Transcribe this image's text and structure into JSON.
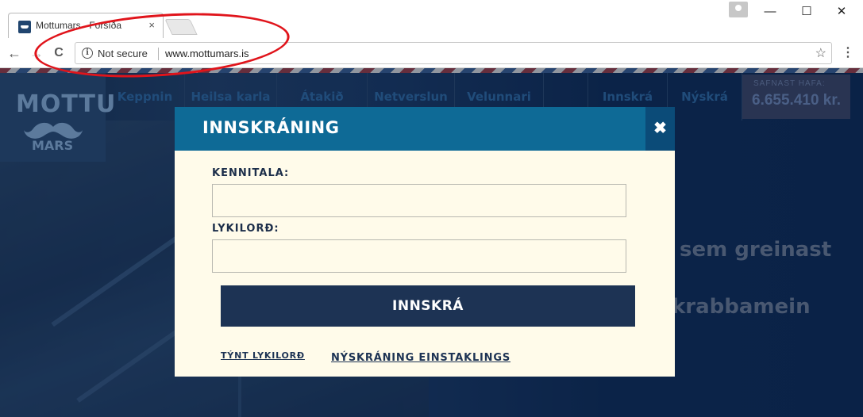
{
  "browser": {
    "tab_title": "Mottumars - Forsíða",
    "tab_close": "×",
    "toolbar": {
      "back_icon": "←",
      "forward_icon": "→",
      "reload_icon": "C",
      "security_label": "Not secure",
      "url": "www.mottumars.is",
      "star_icon": "☆",
      "menu_icon": "⋮"
    },
    "window_controls": {
      "minimize": "—",
      "maximize": "☐",
      "close": "✕"
    }
  },
  "site": {
    "logo": {
      "line1": "MOTTU",
      "line2": "MARS"
    },
    "nav": [
      {
        "label": "Keppnin"
      },
      {
        "label": "Heilsa karla"
      },
      {
        "label": "Átakið"
      },
      {
        "label": "Netverslun"
      },
      {
        "label": "Velunnari"
      },
      {
        "label": ""
      },
      {
        "label": "Innskrá"
      },
      {
        "label": "Nýskrá"
      }
    ],
    "funds": {
      "label": "SAFNAST HAFA:",
      "amount": "6.655.410 kr."
    },
    "hero_lines": [
      "sem greinast",
      "krabbamein"
    ]
  },
  "modal": {
    "title": "INNSKRÁNING",
    "close_icon": "✖",
    "fields": [
      {
        "label": "KENNITALA:",
        "value": "",
        "placeholder": ""
      },
      {
        "label": "LYKILORÐ:",
        "value": "",
        "placeholder": ""
      }
    ],
    "submit_label": "INNSKRÁ",
    "links": {
      "forgot": "TÝNT LYKILORÐ",
      "register": "NÝSKRÁNING EINSTAKLINGS"
    }
  },
  "colors": {
    "modal_header": "#0e6a96",
    "modal_close_bg": "#0b4b78",
    "modal_body": "#fffbea",
    "submit_button": "#1d3354",
    "annotation": "#e0141b"
  }
}
